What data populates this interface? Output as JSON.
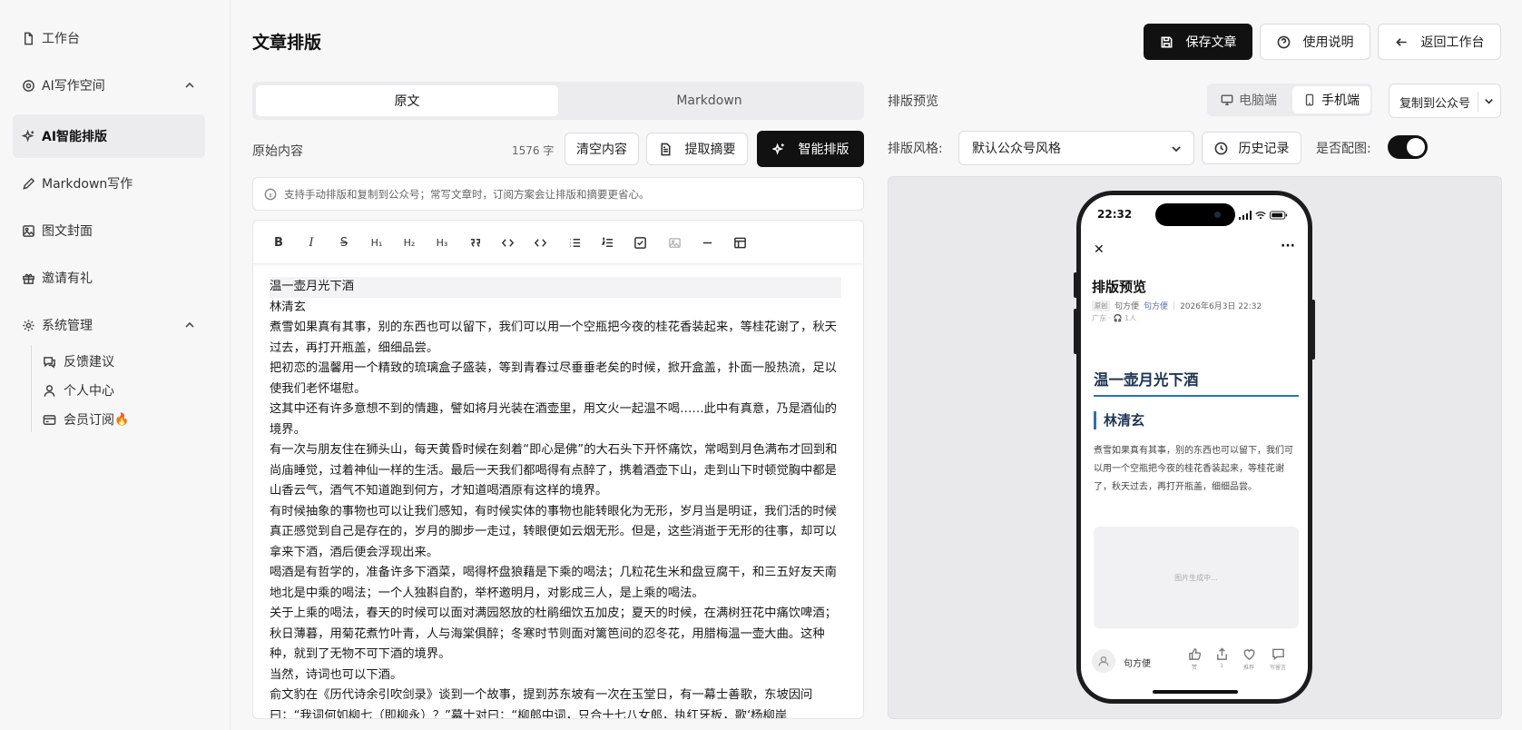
{
  "sidebar": {
    "items": [
      {
        "label": "工作台",
        "icon": "document-icon"
      },
      {
        "label": "AI写作空间",
        "icon": "ai-icon"
      },
      {
        "label": "AI智能排版",
        "icon": "sparkle-icon"
      },
      {
        "label": "Markdown写作",
        "icon": "pen-icon"
      },
      {
        "label": "图文封面",
        "icon": "image-icon"
      },
      {
        "label": "邀请有礼",
        "icon": "gift-icon"
      },
      {
        "label": "系统管理",
        "icon": "gear-icon"
      }
    ],
    "sub_items": [
      {
        "label": "反馈建议",
        "icon": "feedback-icon"
      },
      {
        "label": "个人中心",
        "icon": "user-icon"
      },
      {
        "label": "会员订阅",
        "icon": "card-icon",
        "badge": "🔥"
      }
    ]
  },
  "header": {
    "title": "文章排版",
    "save_label": "保存文章",
    "help_label": "使用说明",
    "back_label": "返回工作台"
  },
  "editor": {
    "tabs": [
      "原文",
      "Markdown"
    ],
    "active_tab": "原文",
    "source_label": "原始内容",
    "word_count": "1576 字",
    "clear_label": "清空内容",
    "summary_label": "提取摘要",
    "smart_label": "智能排版",
    "notice": "支持手动排版和复制到公众号；常写文章时，订阅方案会让排版和摘要更省心。",
    "toolbar": [
      "B",
      "I",
      "S",
      "H1",
      "H2",
      "H3",
      "quote",
      "code",
      "code-block",
      "bullet-list",
      "ordered-list",
      "task-list",
      "image",
      "hr",
      "table"
    ],
    "paragraphs": [
      "温一壶月光下酒",
      "林清玄",
      "煮雪如果真有其事，别的东西也可以留下，我们可以用一个空瓶把今夜的桂花香装起来，等桂花谢了，秋天过去，再打开瓶盖，细细品尝。",
      "把初恋的温馨用一个精致的琉璃盒子盛装，等到青春过尽垂垂老矣的时候，掀开盒盖，扑面一股热流，足以使我们老怀堪慰。",
      "这其中还有许多意想不到的情趣，譬如将月光装在酒壶里，用文火一起温不喝……此中有真意，乃是酒仙的境界。",
      "有一次与朋友住在狮头山，每天黄昏时候在刻着“即心是佛”的大石头下开怀痛饮，常喝到月色满布才回到和尚庙睡觉，过着神仙一样的生活。最后一天我们都喝得有点醉了，携着酒壶下山，走到山下时顿觉胸中都是山香云气，酒气不知道跑到何方，才知道喝酒原有这样的境界。",
      "有时候抽象的事物也可以让我们感知，有时候实体的事物也能转眼化为无形，岁月当是明证，我们活的时候真正感觉到自己是存在的，岁月的脚步一走过，转眼便如云烟无形。但是，这些消逝于无形的往事，却可以拿来下酒，酒后便会浮现出来。",
      "喝酒是有哲学的，准备许多下酒菜，喝得杯盘狼藉是下乘的喝法；几粒花生米和盘豆腐干，和三五好友天南地北是中乘的喝法；一个人独斟自酌，举杯邀明月，对影成三人，是上乘的喝法。",
      "关于上乘的喝法，春天的时候可以面对满园怒放的杜鹃细饮五加皮；夏天的时候，在满树狂花中痛饮啤酒；秋日薄暮，用菊花煮竹叶青，人与海棠俱醉；冬寒时节则面对篱笆间的忍冬花，用腊梅温一壶大曲。这种种，就到了无物不可下酒的境界。",
      "当然，诗词也可以下酒。",
      "俞文豹在《历代诗余引吹剑录》谈到一个故事，提到苏东坡有一次在玉堂日，有一幕士善歌，东坡因问曰：“我词何如柳七（即柳永）？”幕士对曰：“柳郎中词，只合十七八女郎，执红牙板，歌‘杨柳岸"
    ]
  },
  "preview": {
    "label": "排版预览",
    "desktop_label": "电脑端",
    "mobile_label": "手机端",
    "copy_label": "复制到公众号",
    "style_label": "排版风格:",
    "style_value": "默认公众号风格",
    "history_label": "历史记录",
    "illustrate_label": "是否配图:",
    "illustrate_on": true,
    "phone": {
      "time": "22:32",
      "title": "排版预览",
      "tag": "原创",
      "author1": "句方便",
      "author2": "句方便",
      "date": "2026年6月3日 22:32",
      "location": "广东 · 🎧 1人",
      "h1": "温一壶月光下酒",
      "h2": "林清玄",
      "body": "煮雪如果真有其事，别的东西也可以留下，我们可以用一个空瓶把今夜的桂花香装起来，等桂花谢了，秋天过去，再打开瓶盖，细细品尝。",
      "image_placeholder": "图片生成中...",
      "footer_author": "句方便",
      "actions": [
        {
          "icon": "thumb-up-icon",
          "label": "赞"
        },
        {
          "icon": "share-icon",
          "label": "1"
        },
        {
          "icon": "heart-icon",
          "label": "推荐"
        },
        {
          "icon": "comment-icon",
          "label": "写留言"
        }
      ]
    }
  }
}
